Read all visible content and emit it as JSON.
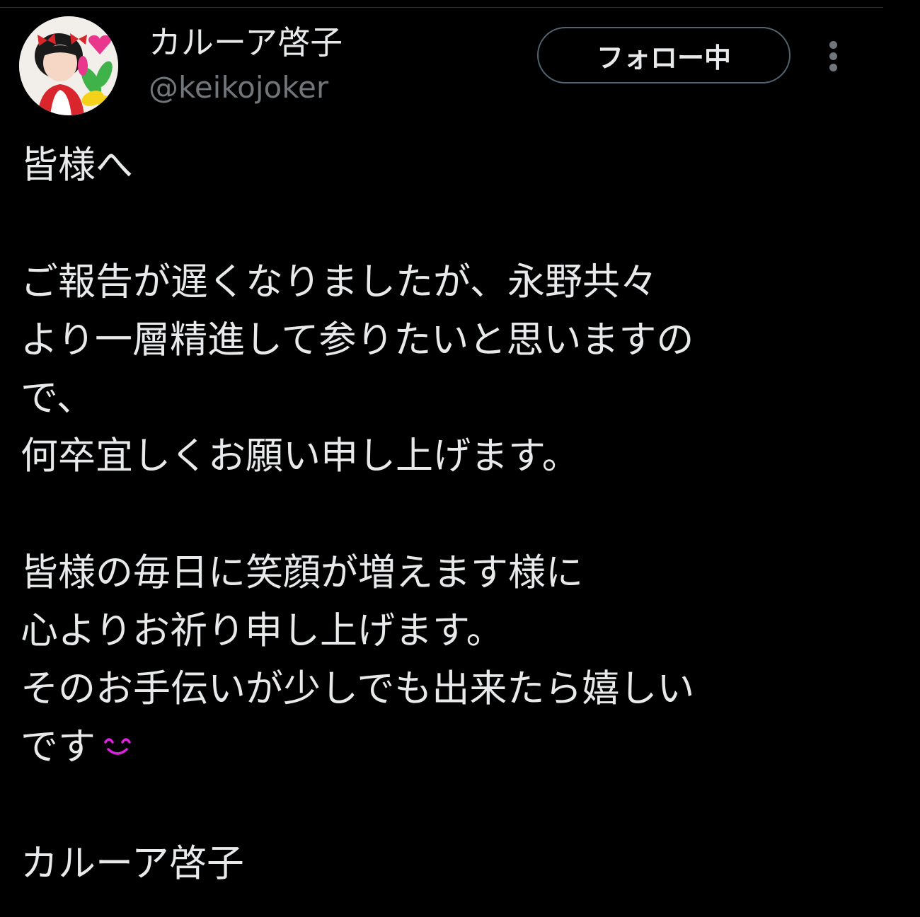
{
  "tweet": {
    "author": {
      "display_name": "カルーア啓子",
      "handle": "@keikojoker",
      "avatar_icon": "profile-photo"
    },
    "follow_button_label": "フォロー中",
    "more_icon": "more-vertical-icon",
    "body_lines": [
      "皆様へ",
      "",
      "ご報告が遅くなりましたが、永野共々",
      "より一層精進して参りたいと思いますの",
      "で、",
      "何卒宜しくお願い申し上げます。",
      "",
      "皆様の毎日に笑顔が増えます様に",
      "心よりお祈り申し上げます。",
      "そのお手伝いが少しでも出来たら嬉しい",
      "です",
      "",
      "カルーア啓子"
    ],
    "emoji": "smiling-eyes-emoticon",
    "colors": {
      "background": "#000000",
      "text": "#e7e9ea",
      "secondary_text": "#71767b",
      "button_border": "#536471",
      "emoji": "#e020e0"
    }
  }
}
